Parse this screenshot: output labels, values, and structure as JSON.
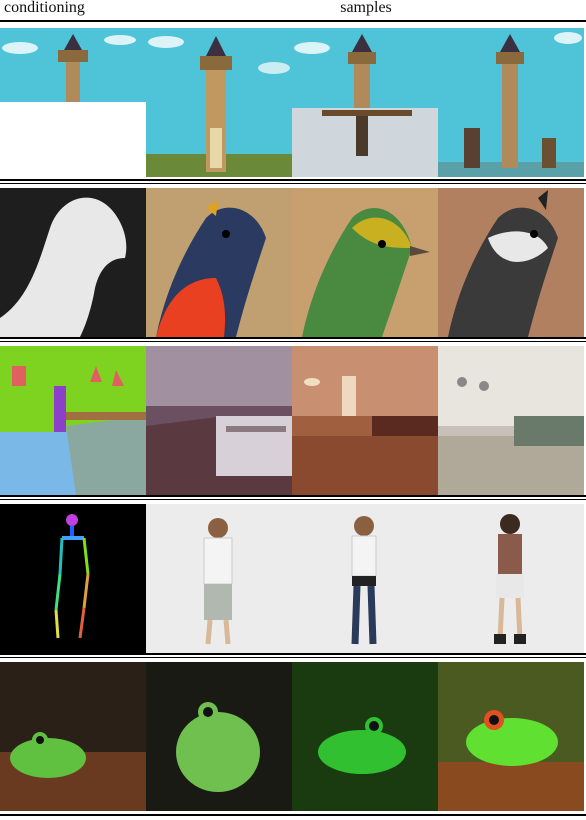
{
  "header": {
    "conditioning_label": "conditioning",
    "samples_label": "samples"
  },
  "rows": [
    {
      "conditioning": "inpainting-mask-lighthouse",
      "samples": [
        "lighthouse-sample-1",
        "lighthouse-sample-2",
        "lighthouse-sample-3"
      ]
    },
    {
      "conditioning": "bird-silhouette-mask",
      "samples": [
        "bird-sample-1",
        "bird-sample-2",
        "bird-sample-3"
      ]
    },
    {
      "conditioning": "semantic-segmentation-room",
      "samples": [
        "room-sample-1",
        "room-sample-2",
        "room-sample-3"
      ]
    },
    {
      "conditioning": "pose-skeleton",
      "samples": [
        "person-sample-1",
        "person-sample-2",
        "person-sample-3"
      ]
    },
    {
      "conditioning": "frog-source-image",
      "samples": [
        "frog-sample-1",
        "frog-sample-2",
        "frog-sample-3"
      ]
    }
  ],
  "colors": {
    "sky": "#4fc3d8",
    "frame": "#000000",
    "segmentation_green": "#7ed321",
    "segmentation_blue": "#7ab8e8"
  }
}
